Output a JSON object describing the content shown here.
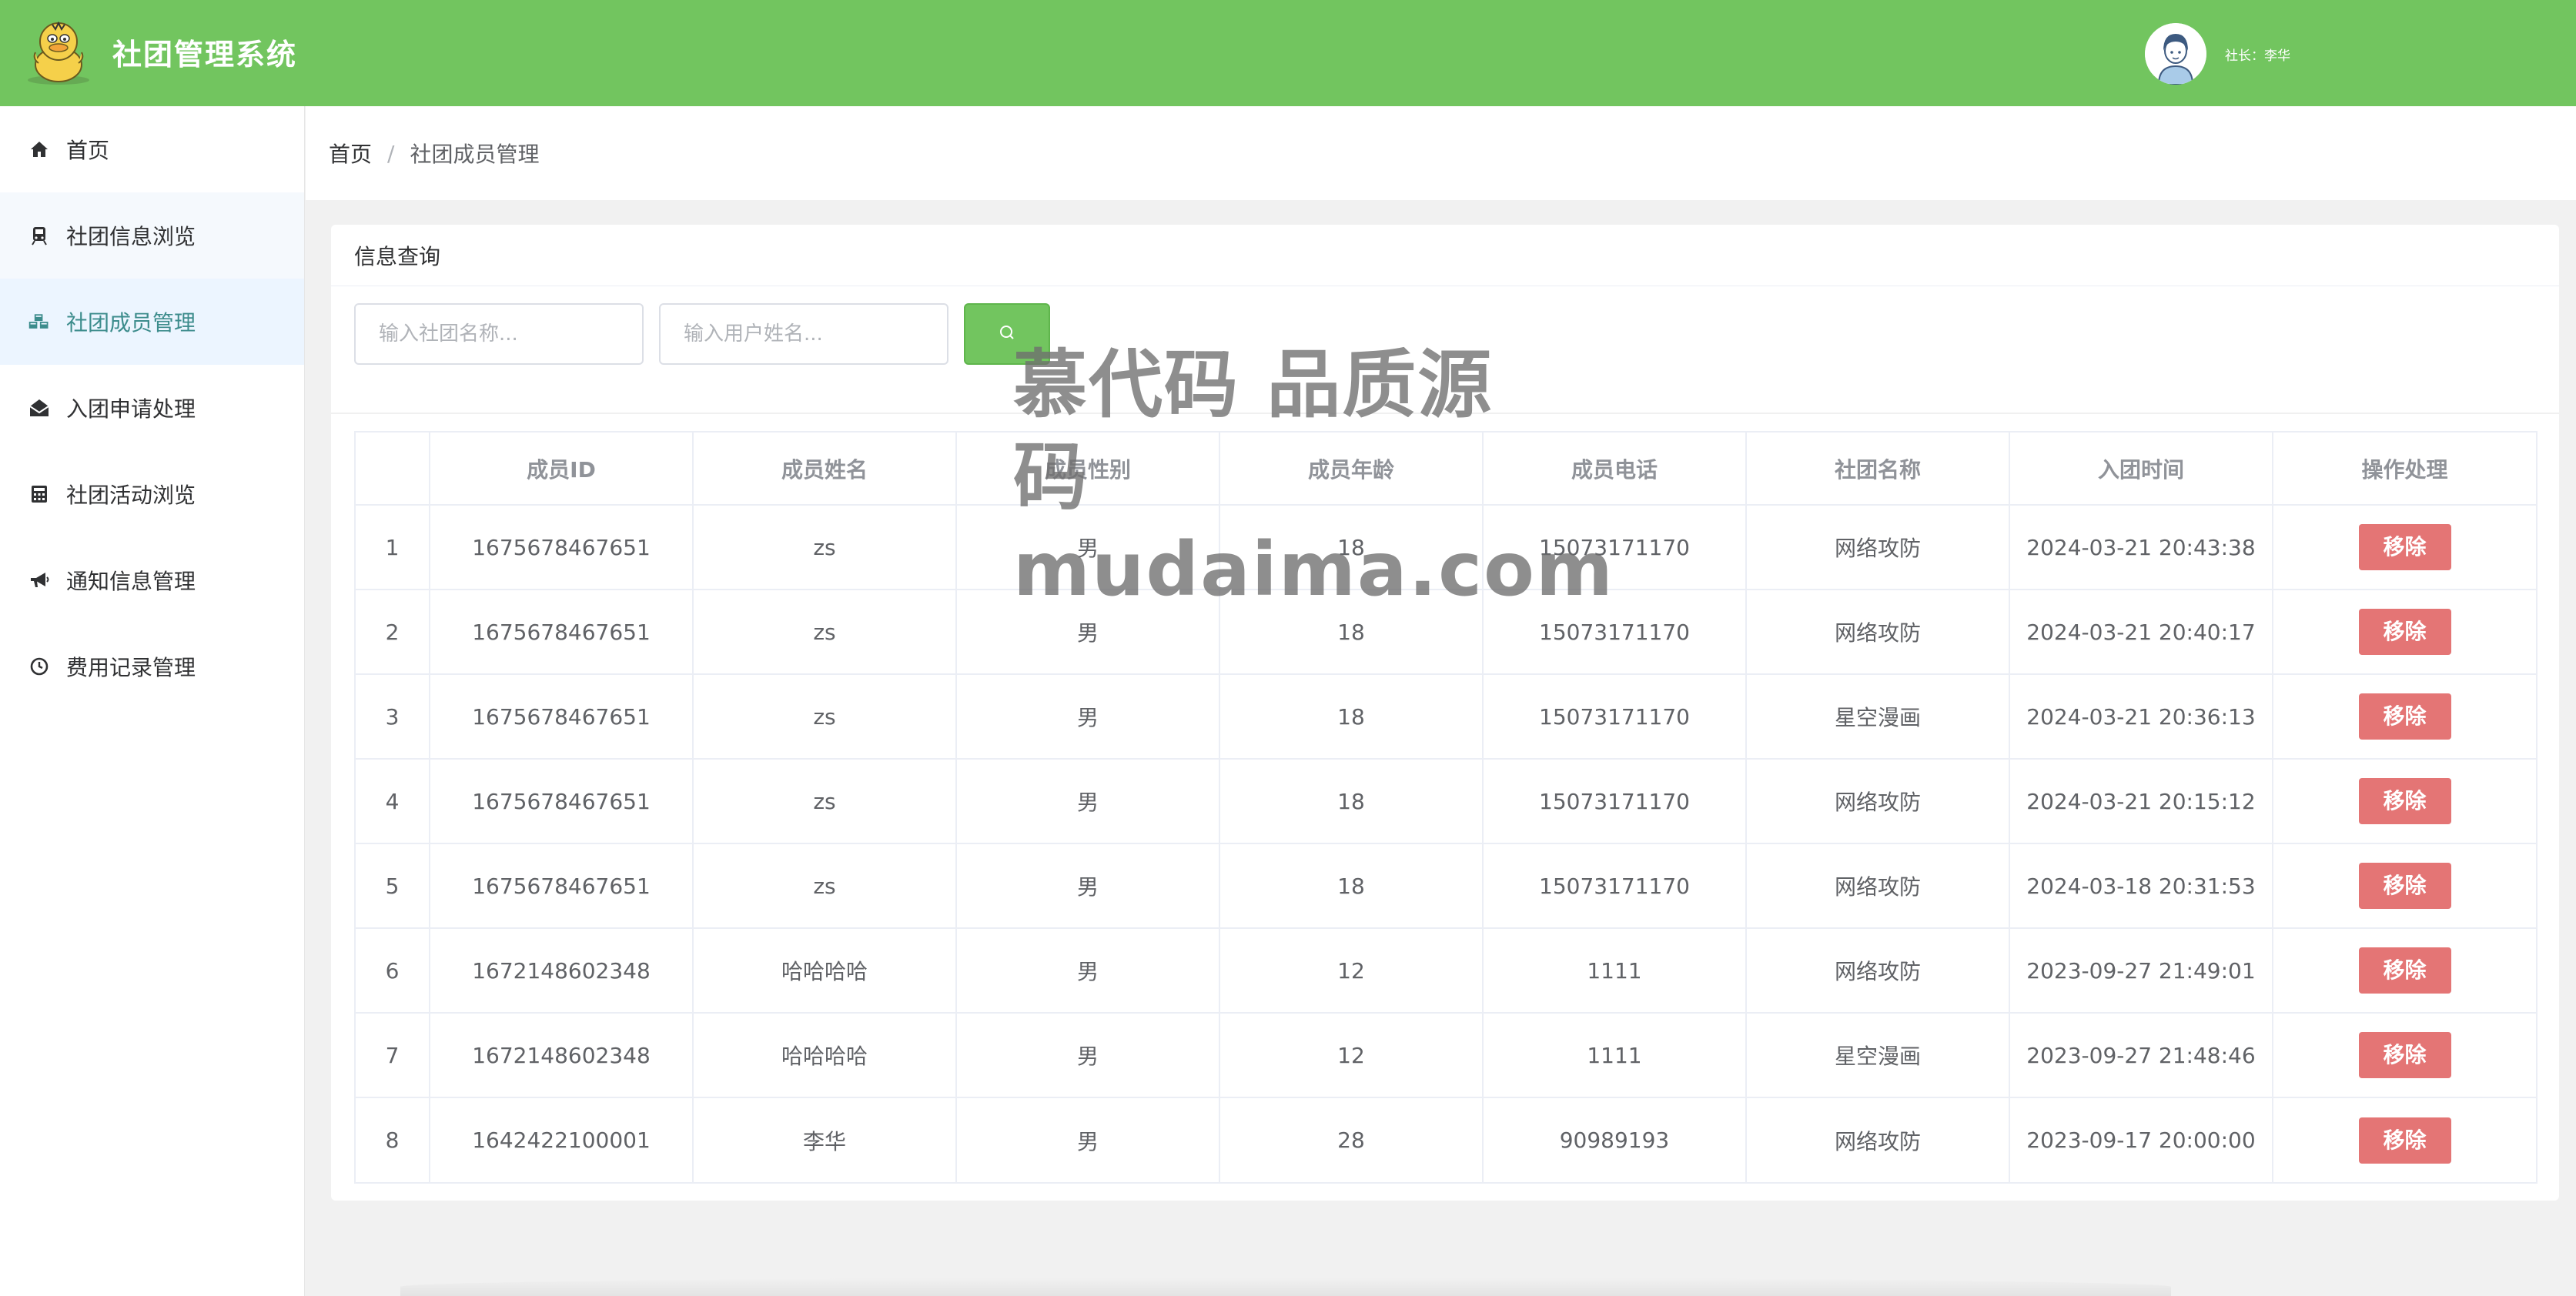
{
  "header": {
    "app_title": "社团管理系统",
    "user_label": "社长：李华"
  },
  "sidebar": {
    "items": [
      {
        "label": "首页",
        "icon": "home-icon"
      },
      {
        "label": "社团信息浏览",
        "icon": "train-icon"
      },
      {
        "label": "社团成员管理",
        "icon": "cubes-icon"
      },
      {
        "label": "入团申请处理",
        "icon": "envelope-open-icon"
      },
      {
        "label": "社团活动浏览",
        "icon": "calculator-icon"
      },
      {
        "label": "通知信息管理",
        "icon": "bullhorn-icon"
      },
      {
        "label": "费用记录管理",
        "icon": "clock-icon"
      }
    ],
    "active_index": 2,
    "hover_index": 1
  },
  "breadcrumb": {
    "home": "首页",
    "separator": "/",
    "current": "社团成员管理"
  },
  "card": {
    "title": "信息查询",
    "club_name_placeholder": "输入社团名称...",
    "user_name_placeholder": "输入用户姓名...",
    "search_icon": "search-icon"
  },
  "table": {
    "headers": [
      "",
      "成员ID",
      "成员姓名",
      "成员性别",
      "成员年龄",
      "成员电话",
      "社团名称",
      "入团时间",
      "操作处理"
    ],
    "remove_label": "移除",
    "rows": [
      {
        "idx": "1",
        "id": "1675678467651",
        "name": "zs",
        "gender": "男",
        "age": "18",
        "phone": "15073171170",
        "club": "网络攻防",
        "time": "2024-03-21 20:43:38"
      },
      {
        "idx": "2",
        "id": "1675678467651",
        "name": "zs",
        "gender": "男",
        "age": "18",
        "phone": "15073171170",
        "club": "网络攻防",
        "time": "2024-03-21 20:40:17"
      },
      {
        "idx": "3",
        "id": "1675678467651",
        "name": "zs",
        "gender": "男",
        "age": "18",
        "phone": "15073171170",
        "club": "星空漫画",
        "time": "2024-03-21 20:36:13"
      },
      {
        "idx": "4",
        "id": "1675678467651",
        "name": "zs",
        "gender": "男",
        "age": "18",
        "phone": "15073171170",
        "club": "网络攻防",
        "time": "2024-03-21 20:15:12"
      },
      {
        "idx": "5",
        "id": "1675678467651",
        "name": "zs",
        "gender": "男",
        "age": "18",
        "phone": "15073171170",
        "club": "网络攻防",
        "time": "2024-03-18 20:31:53"
      },
      {
        "idx": "6",
        "id": "1672148602348",
        "name": "哈哈哈哈",
        "gender": "男",
        "age": "12",
        "phone": "1111",
        "club": "网络攻防",
        "time": "2023-09-27 21:49:01"
      },
      {
        "idx": "7",
        "id": "1672148602348",
        "name": "哈哈哈哈",
        "gender": "男",
        "age": "12",
        "phone": "1111",
        "club": "星空漫画",
        "time": "2023-09-27 21:48:46"
      },
      {
        "idx": "8",
        "id": "1642422100001",
        "name": "李华",
        "gender": "男",
        "age": "28",
        "phone": "90989193",
        "club": "网络攻防",
        "time": "2023-09-17 20:00:00"
      }
    ]
  },
  "watermark": {
    "line1": "慕代码 品质源码",
    "line2": "mudaima.com"
  },
  "colors": {
    "header_green": "#72c55f",
    "remove_red": "#e47575",
    "active_text": "#3c8c8c"
  }
}
